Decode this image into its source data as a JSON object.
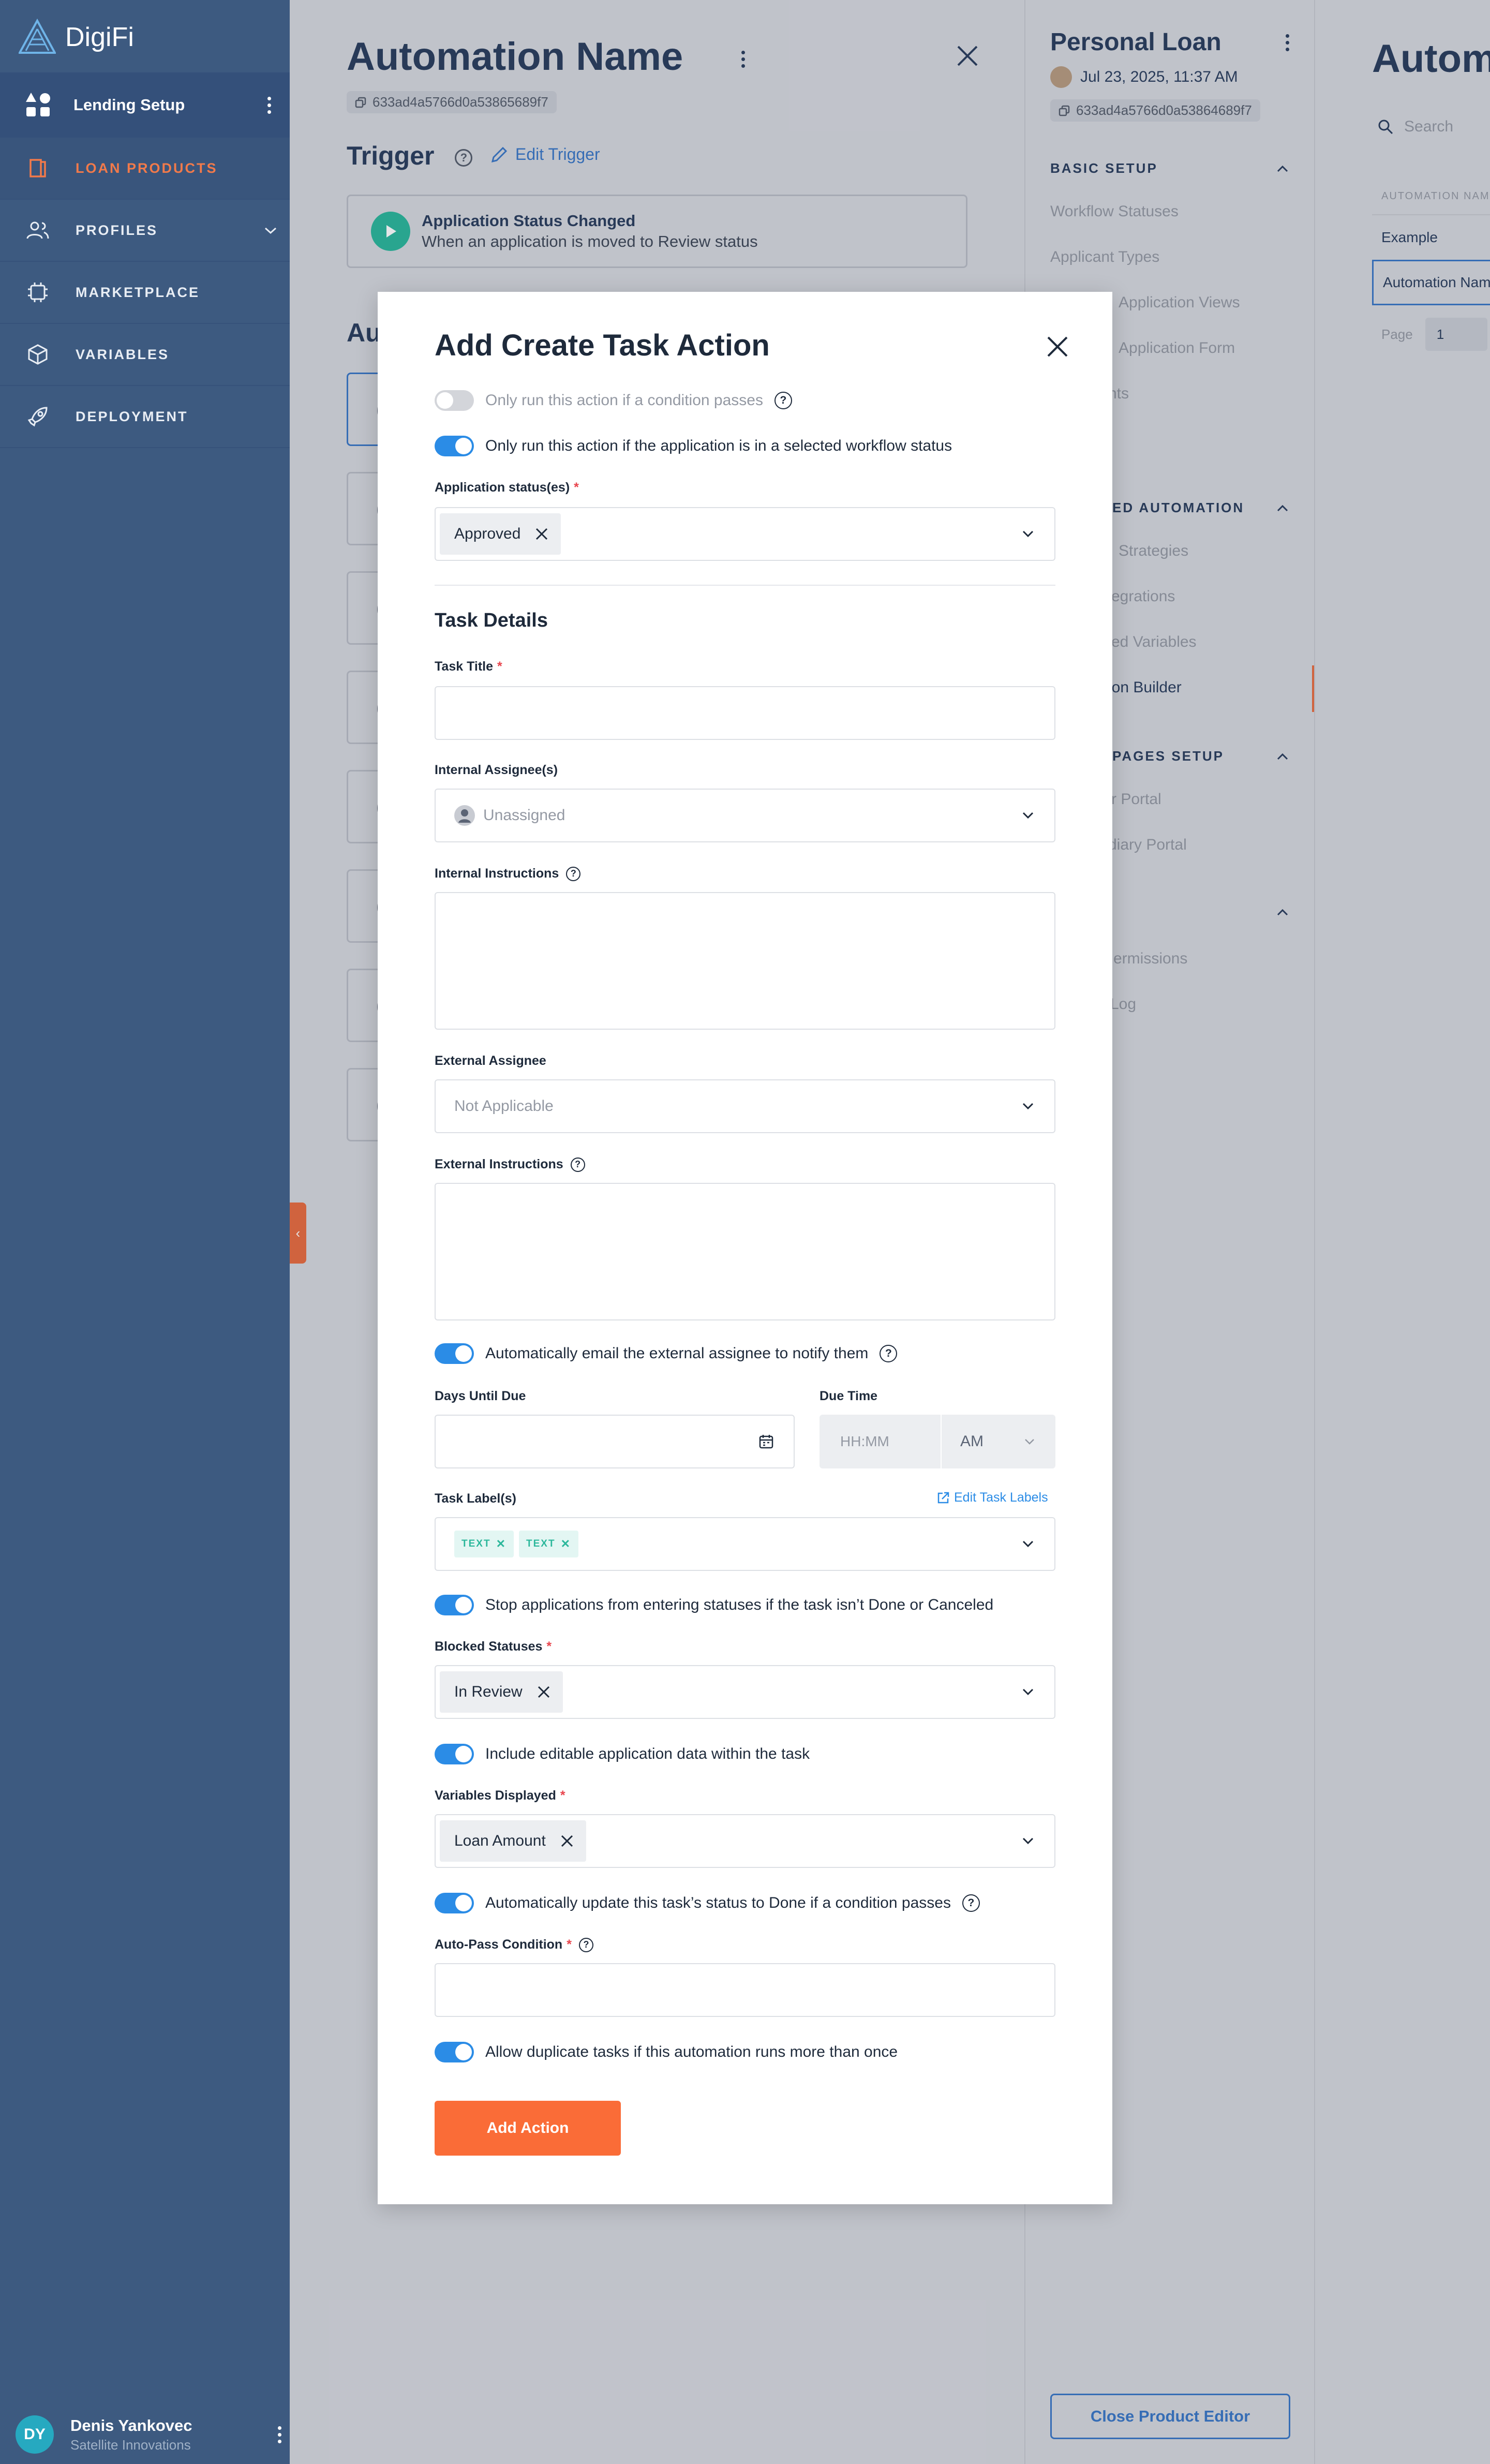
{
  "sidebar": {
    "logo_text": "DigiFi",
    "lending_setup": "Lending Setup",
    "nav": [
      {
        "label": "LOAN PRODUCTS",
        "icon": "book-icon",
        "active": true
      },
      {
        "label": "PROFILES",
        "icon": "users-icon"
      },
      {
        "label": "MARKETPLACE",
        "icon": "chip-icon"
      },
      {
        "label": "VARIABLES",
        "icon": "cube-icon"
      },
      {
        "label": "DEPLOYMENT",
        "icon": "rocket-icon"
      }
    ],
    "user": {
      "initials": "DY",
      "name": "Denis Yankovec",
      "org": "Satellite Innovations"
    }
  },
  "editor": {
    "title": "Automation Name",
    "id": "633ad4a5766d0a53865689f7",
    "trigger_label": "Trigger",
    "edit_trigger": "Edit Trigger",
    "trigger_title": "Application Status Changed",
    "trigger_sub": "When an application is moved to Review status",
    "actions_partial": "Au"
  },
  "product_panel": {
    "title": "Personal Loan",
    "date": "Jul 23, 2025, 11:37 AM",
    "id": "633ad4a5766d0a53864689f7",
    "sections": [
      {
        "title": "BASIC SETUP",
        "items": [
          "Workflow Statuses",
          "Applicant Types",
          "Application Views",
          "Application Form",
          "nts"
        ]
      },
      {
        "title": "ED AUTOMATION",
        "items": [
          "Strategies",
          "egrations",
          "ed Variables",
          "ion Builder"
        ]
      },
      {
        "title": "PAGES SETUP",
        "items": [
          "r Portal",
          "diary Portal"
        ]
      },
      {
        "title": "",
        "items": [
          "ermissions",
          "Log"
        ]
      }
    ],
    "close_button": "Close Product Editor"
  },
  "right_panel": {
    "title": "Autom",
    "search_placeholder": "Search",
    "column_header": "AUTOMATION NAME",
    "rows": [
      "Example",
      "Automation Name"
    ],
    "page_label": "Page",
    "page_value": "1"
  },
  "modal": {
    "title": "Add Create Task Action",
    "condition_toggle": {
      "label": "Only run this action if a condition passes",
      "on": false
    },
    "status_toggle": {
      "label": "Only run this action if the application is in a selected workflow status",
      "on": true
    },
    "app_status_label": "Application status(es)",
    "app_status_value": "Approved",
    "task_details": "Task Details",
    "task_title_label": "Task Title",
    "task_title_value": "",
    "internal_assignee_label": "Internal Assignee(s)",
    "internal_assignee_value": "Unassigned",
    "internal_instructions_label": "Internal Instructions",
    "external_assignee_label": "External Assignee",
    "external_assignee_value": "Not Applicable",
    "external_instructions_label": "External Instructions",
    "email_toggle": {
      "label": "Automatically email the external assignee to notify them",
      "on": true
    },
    "days_until_due_label": "Days Until Due",
    "due_time_label": "Due Time",
    "due_time_placeholder": "HH:MM",
    "due_time_period": "AM",
    "task_labels_label": "Task Label(s)",
    "edit_task_labels": "Edit Task Labels",
    "task_labels": [
      "TEXT",
      "TEXT"
    ],
    "tag_color": "#2bb79b",
    "stop_toggle": {
      "label": "Stop applications from entering statuses if the task isn’t Done or Canceled",
      "on": true
    },
    "blocked_statuses_label": "Blocked Statuses",
    "blocked_statuses_value": "In Review",
    "include_toggle": {
      "label": "Include editable application data within the task",
      "on": true
    },
    "variables_label": "Variables Displayed",
    "variables_value": "Loan Amount",
    "auto_update_toggle": {
      "label": "Automatically update this task’s status to Done if a condition passes",
      "on": true
    },
    "auto_pass_label": "Auto-Pass Condition",
    "duplicate_toggle": {
      "label": "Allow duplicate tasks if this automation runs more than once",
      "on": true
    },
    "add_action": "Add Action",
    "accent_color": "#fa6c37",
    "toggle_color": "#2b8ce6"
  }
}
